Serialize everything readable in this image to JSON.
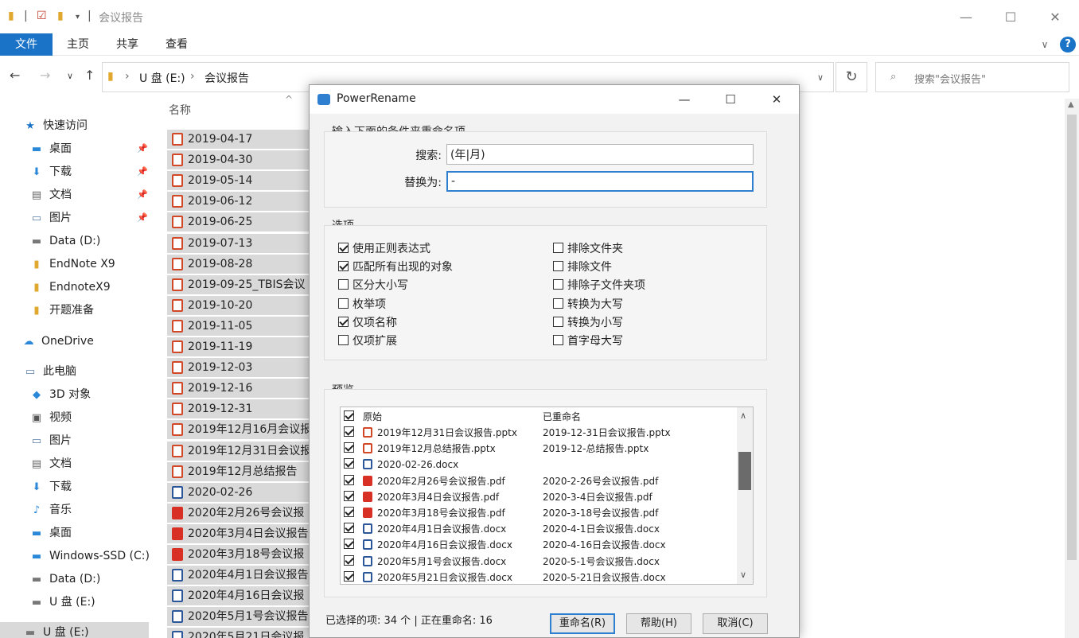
{
  "window": {
    "title": "会议报告",
    "minimize": "—",
    "maximize": "☐",
    "close": "✕"
  },
  "ribbon": {
    "tabs": [
      "文件",
      "主页",
      "共享",
      "查看"
    ],
    "expand": "∨",
    "help": "?"
  },
  "address": {
    "path": [
      "U 盘 (E:)",
      "会议报告"
    ],
    "search_placeholder": "搜索\"会议报告\""
  },
  "nav": {
    "quick_access": "快速访问",
    "quick_items": [
      {
        "label": "桌面",
        "icon": "desktop-icon"
      },
      {
        "label": "下载",
        "icon": "download-icon"
      },
      {
        "label": "文档",
        "icon": "document-icon"
      },
      {
        "label": "图片",
        "icon": "picture-icon"
      }
    ],
    "drives_top": [
      "Data (D:)",
      "EndNote X9",
      "EndnoteX9",
      "开题准备"
    ],
    "onedrive": "OneDrive",
    "this_pc": "此电脑",
    "pc_items": [
      "3D 对象",
      "视频",
      "图片",
      "文档",
      "下载",
      "音乐",
      "桌面",
      "Windows-SSD (C:)",
      "Data (D:)",
      "U 盘 (E:)"
    ],
    "bottom_partial": "U 盘 (E:)"
  },
  "files": {
    "column_name": "名称",
    "items": [
      {
        "name": "2019-04-17",
        "type": "ppt"
      },
      {
        "name": "2019-04-30",
        "type": "ppt"
      },
      {
        "name": "2019-05-14",
        "type": "ppt"
      },
      {
        "name": "2019-06-12",
        "type": "ppt"
      },
      {
        "name": "2019-06-25",
        "type": "ppt"
      },
      {
        "name": "2019-07-13",
        "type": "ppt"
      },
      {
        "name": "2019-08-28",
        "type": "ppt"
      },
      {
        "name": "2019-09-25_TBIS会议",
        "type": "ppt"
      },
      {
        "name": "2019-10-20",
        "type": "ppt"
      },
      {
        "name": "2019-11-05",
        "type": "ppt"
      },
      {
        "name": "2019-11-19",
        "type": "ppt"
      },
      {
        "name": "2019-12-03",
        "type": "ppt"
      },
      {
        "name": "2019-12-16",
        "type": "ppt"
      },
      {
        "name": "2019-12-31",
        "type": "ppt"
      },
      {
        "name": "2019年12月16月会议报",
        "type": "ppt"
      },
      {
        "name": "2019年12月31日会议报",
        "type": "ppt"
      },
      {
        "name": "2019年12月总结报告",
        "type": "ppt"
      },
      {
        "name": "2020-02-26",
        "type": "doc"
      },
      {
        "name": "2020年2月26号会议报",
        "type": "pdf"
      },
      {
        "name": "2020年3月4日会议报告",
        "type": "pdf"
      },
      {
        "name": "2020年3月18号会议报",
        "type": "pdf"
      },
      {
        "name": "2020年4月1日会议报告",
        "type": "doc"
      },
      {
        "name": "2020年4月16日会议报",
        "type": "doc"
      },
      {
        "name": "2020年5月1号会议报告",
        "type": "doc"
      },
      {
        "name": "2020年5月21日会议报",
        "type": "doc"
      }
    ]
  },
  "dialog": {
    "title": "PowerRename",
    "section_criteria": "输入下面的条件来重命名项",
    "search_label": "搜索:",
    "search_value": "(年|月)",
    "replace_label": "替换为:",
    "replace_value": "-",
    "section_options": "选项",
    "options_left": [
      {
        "label": "使用正则表达式",
        "checked": true
      },
      {
        "label": "匹配所有出现的对象",
        "checked": true
      },
      {
        "label": "区分大小写",
        "checked": false
      },
      {
        "label": "枚举项",
        "checked": false
      },
      {
        "label": "仅项名称",
        "checked": true
      },
      {
        "label": "仅项扩展",
        "checked": false
      }
    ],
    "options_right": [
      {
        "label": "排除文件夹",
        "checked": false
      },
      {
        "label": "排除文件",
        "checked": false
      },
      {
        "label": "排除子文件夹项",
        "checked": false
      },
      {
        "label": "转换为大写",
        "checked": false
      },
      {
        "label": "转换为小写",
        "checked": false
      },
      {
        "label": "首字母大写",
        "checked": false
      }
    ],
    "section_preview": "预览",
    "col_original": "原始",
    "col_renamed": "已重命名",
    "preview_rows": [
      {
        "original": "2019年12月31日会议报告.pptx",
        "renamed": "2019-12-31日会议报告.pptx",
        "type": "ppt"
      },
      {
        "original": "2019年12月总结报告.pptx",
        "renamed": "2019-12-总结报告.pptx",
        "type": "ppt"
      },
      {
        "original": "2020-02-26.docx",
        "renamed": "",
        "type": "doc"
      },
      {
        "original": "2020年2月26号会议报告.pdf",
        "renamed": "2020-2-26号会议报告.pdf",
        "type": "pdf"
      },
      {
        "original": "2020年3月4日会议报告.pdf",
        "renamed": "2020-3-4日会议报告.pdf",
        "type": "pdf"
      },
      {
        "original": "2020年3月18号会议报告.pdf",
        "renamed": "2020-3-18号会议报告.pdf",
        "type": "pdf"
      },
      {
        "original": "2020年4月1日会议报告.docx",
        "renamed": "2020-4-1日会议报告.docx",
        "type": "doc"
      },
      {
        "original": "2020年4月16日会议报告.docx",
        "renamed": "2020-4-16日会议报告.docx",
        "type": "doc"
      },
      {
        "original": "2020年5月1号会议报告.docx",
        "renamed": "2020-5-1号会议报告.docx",
        "type": "doc"
      },
      {
        "original": "2020年5月21日会议报告.docx",
        "renamed": "2020-5-21日会议报告.docx",
        "type": "doc"
      }
    ],
    "status": "已选择的项: 34 个 | 正在重命名: 16",
    "btn_rename": "重命名(R)",
    "btn_help": "帮助(H)",
    "btn_cancel": "取消(C)"
  },
  "colors": {
    "accent": "#1a73c7",
    "selection": "#d9d9d9",
    "focus": "#2f7fd0"
  }
}
